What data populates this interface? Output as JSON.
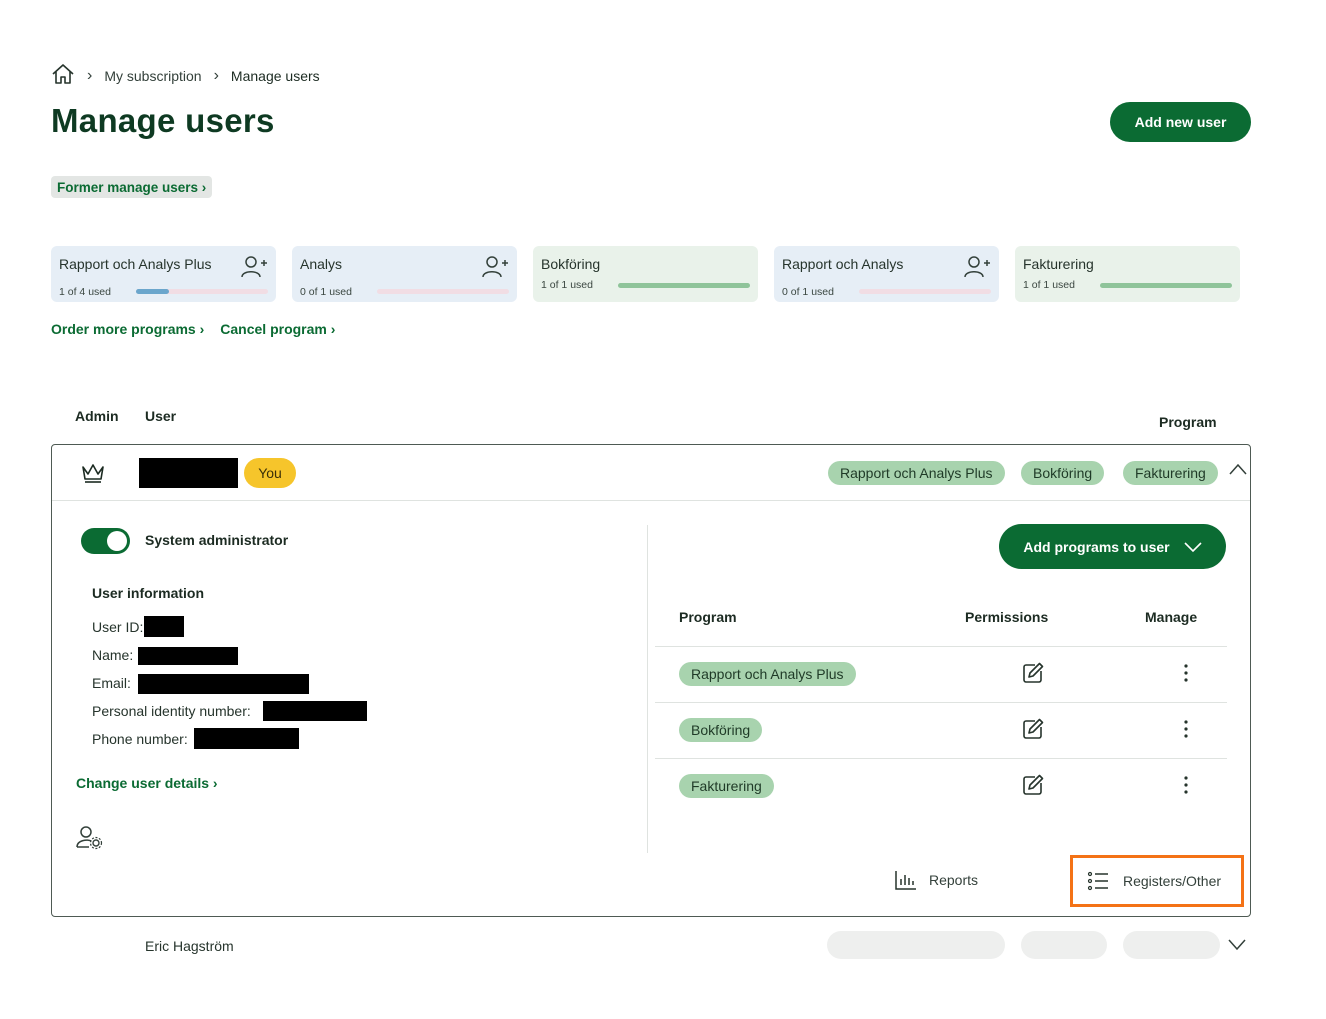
{
  "breadcrumb": {
    "items": [
      "My subscription",
      "Manage users"
    ]
  },
  "page": {
    "title": "Manage users",
    "add_user_label": "Add new user",
    "former_link": "Former manage users ›"
  },
  "subscriptions": [
    {
      "name": "Rapport och Analys Plus",
      "used": "1 of 4 used",
      "fraction": 0.25,
      "style": "blue",
      "can_add": true
    },
    {
      "name": "Analys",
      "used": "0 of 1 used",
      "fraction": 0,
      "style": "blue",
      "can_add": true
    },
    {
      "name": "Bokföring",
      "used": "1 of 1 used",
      "fraction": 1,
      "style": "green",
      "can_add": false
    },
    {
      "name": "Rapport och Analys",
      "used": "0 of 1 used",
      "fraction": 0,
      "style": "blue",
      "can_add": true
    },
    {
      "name": "Fakturering",
      "used": "1 of 1 used",
      "fraction": 1,
      "style": "green",
      "can_add": false
    }
  ],
  "links": {
    "order_more": "Order more programs ›",
    "cancel": "Cancel program ›"
  },
  "columns": {
    "admin": "Admin",
    "user": "User",
    "program": "Program"
  },
  "current_user": {
    "you_badge": "You",
    "programs": [
      "Rapport och Analys Plus",
      "Bokföring",
      "Fakturering"
    ],
    "system_admin_label": "System administrator",
    "system_admin_on": true,
    "info_title": "User information",
    "info_labels": {
      "user_id": "User ID:",
      "name": "Name:",
      "email": "Email:",
      "pin": "Personal identity number:",
      "phone": "Phone number:"
    },
    "change_details": "Change user details ›",
    "add_programs_label": "Add programs to user",
    "table_headers": {
      "program": "Program",
      "permissions": "Permissions",
      "manage": "Manage"
    },
    "program_rows": [
      "Rapport och Analys Plus",
      "Bokföring",
      "Fakturering"
    ],
    "reports_label": "Reports",
    "registers_label": "Registers/Other"
  },
  "next_user": {
    "name": "Eric Hagström"
  },
  "colors": {
    "brand_green": "#0b6b33",
    "pill_green": "#a8d3ae",
    "you_yellow": "#f6c52b",
    "highlight_orange": "#f47216"
  }
}
